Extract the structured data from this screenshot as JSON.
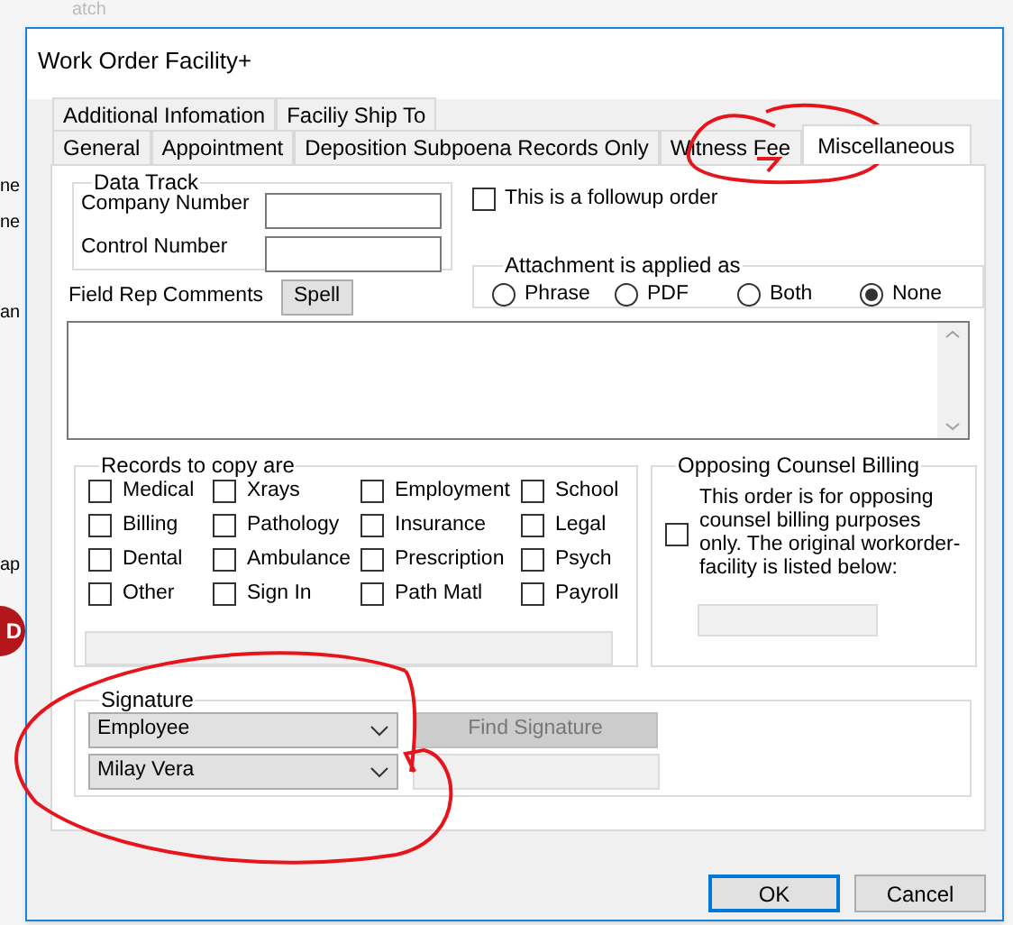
{
  "background": {
    "fragments": [
      "atch",
      "ne",
      "ne",
      "an",
      "ap"
    ],
    "badge": "D"
  },
  "window": {
    "title": "Work Order Facility+"
  },
  "tab_rows": [
    [
      {
        "label": "Additional Infomation",
        "selected": false
      },
      {
        "label": "Faciliy Ship To",
        "selected": false
      }
    ],
    [
      {
        "label": "General",
        "selected": false
      },
      {
        "label": "Appointment",
        "selected": false
      },
      {
        "label": "Deposition Subpoena Records Only",
        "selected": false
      },
      {
        "label": "Witness Fee",
        "selected": false
      },
      {
        "label": "Miscellaneous",
        "selected": true
      }
    ]
  ],
  "data_track": {
    "title": "Data Track",
    "fields": [
      {
        "label": "Company Number"
      },
      {
        "label": "Control Number"
      }
    ]
  },
  "followup": {
    "label": "This is a followup order",
    "checked": false
  },
  "attachment": {
    "title": "Attachment is applied as",
    "options": [
      {
        "label": "Phrase",
        "selected": false
      },
      {
        "label": "PDF",
        "selected": false
      },
      {
        "label": "Both",
        "selected": false
      },
      {
        "label": "None",
        "selected": true
      }
    ]
  },
  "comments": {
    "label": "Field Rep Comments",
    "button": "Spell"
  },
  "records": {
    "title": "Records to copy are",
    "items": [
      {
        "label": "Medical",
        "checked": false
      },
      {
        "label": "Xrays",
        "checked": false
      },
      {
        "label": "Employment",
        "checked": false
      },
      {
        "label": "School",
        "checked": false
      },
      {
        "label": "Billing",
        "checked": false
      },
      {
        "label": "Pathology",
        "checked": false
      },
      {
        "label": "Insurance",
        "checked": false
      },
      {
        "label": "Legal",
        "checked": false
      },
      {
        "label": "Dental",
        "checked": false
      },
      {
        "label": "Ambulance",
        "checked": false
      },
      {
        "label": "Prescription",
        "checked": false
      },
      {
        "label": "Psych",
        "checked": false
      },
      {
        "label": "Other",
        "checked": false
      },
      {
        "label": "Sign In",
        "checked": false
      },
      {
        "label": "Path Matl",
        "checked": false
      },
      {
        "label": "Payroll",
        "checked": false
      }
    ]
  },
  "opposing": {
    "title": "Opposing Counsel Billing",
    "text": "This order is for opposing counsel billing purposes only. The original workorder-facility is listed below:",
    "checked": false
  },
  "signature": {
    "title": "Signature",
    "selects": [
      {
        "value": "Employee"
      },
      {
        "value": "Milay Vera"
      }
    ],
    "find_button": {
      "label": "Find Signature",
      "disabled": true
    }
  },
  "buttons": [
    {
      "label": "OK",
      "default": true
    },
    {
      "label": "Cancel",
      "default": false
    }
  ],
  "annotations": {
    "tab_loop": true,
    "signature_loop": true
  }
}
